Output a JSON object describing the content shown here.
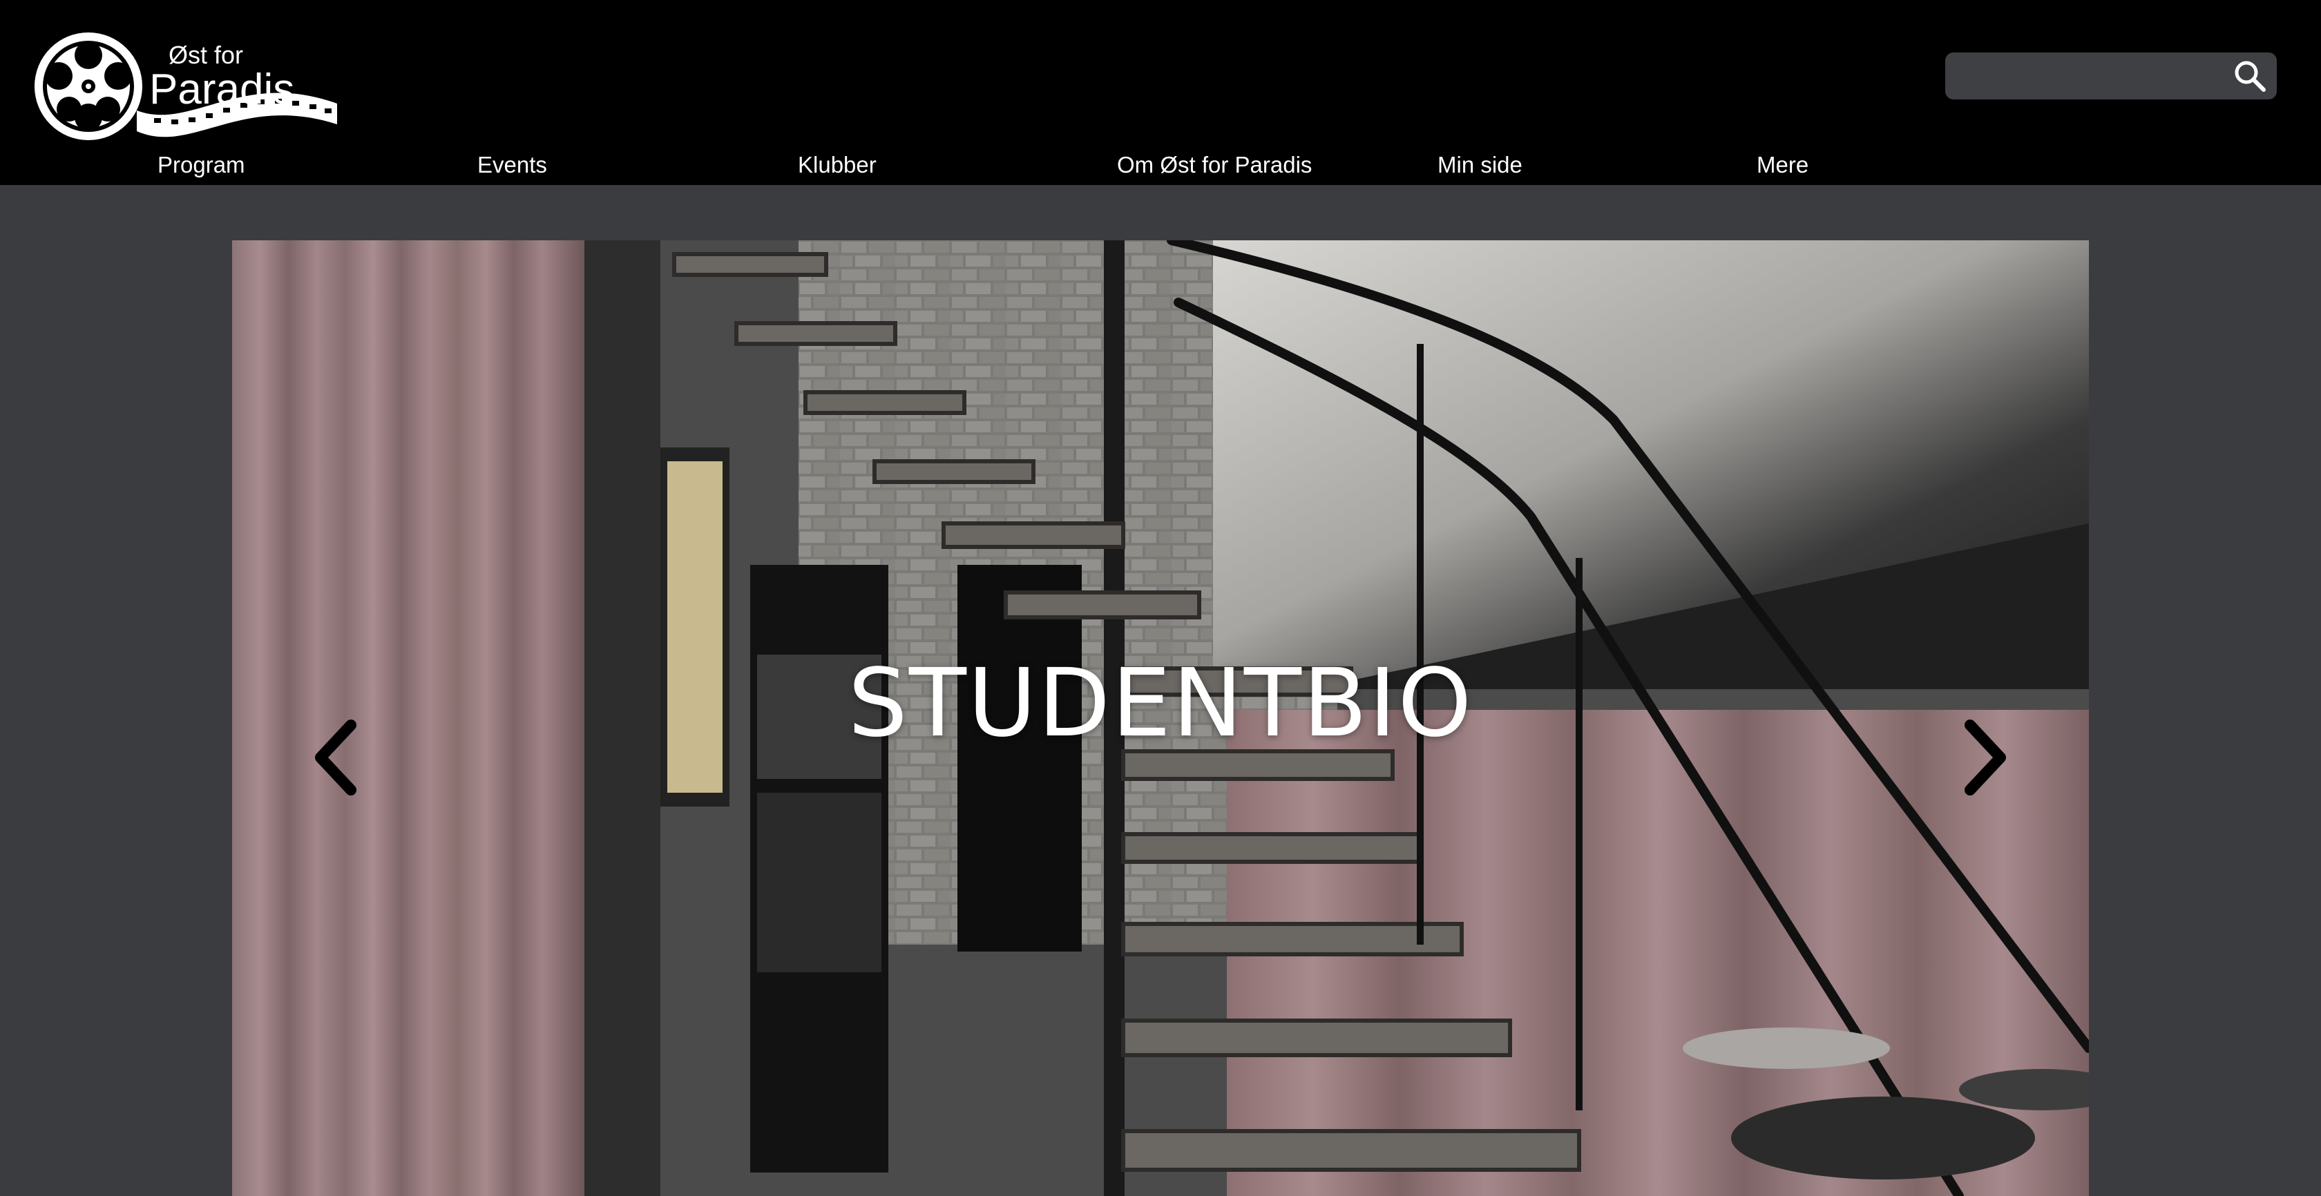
{
  "brand": {
    "line1": "Øst for",
    "line2": "Paradis"
  },
  "search": {
    "placeholder": "",
    "value": ""
  },
  "nav": {
    "items": [
      "Program",
      "Events",
      "Klubber",
      "Om Øst for Paradis",
      "Min side",
      "Mere"
    ]
  },
  "hero": {
    "title": "STUDENTBIO",
    "prev_icon": "chevron-left-icon",
    "next_icon": "chevron-right-icon"
  },
  "colors": {
    "header_bg": "#000000",
    "page_bg": "#3b3c3f",
    "search_bg": "#3f4043",
    "text": "#ffffff"
  }
}
